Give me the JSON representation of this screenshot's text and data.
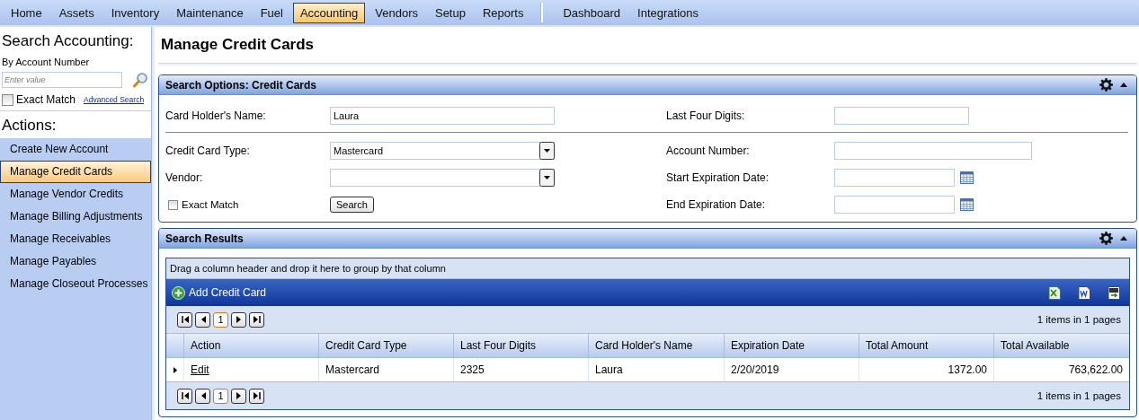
{
  "menu": {
    "items": [
      {
        "label": "Home",
        "selected": false
      },
      {
        "label": "Assets",
        "selected": false
      },
      {
        "label": "Inventory",
        "selected": false
      },
      {
        "label": "Maintenance",
        "selected": false
      },
      {
        "label": "Fuel",
        "selected": false
      },
      {
        "label": "Accounting",
        "selected": true
      },
      {
        "label": "Vendors",
        "selected": false
      },
      {
        "label": "Setup",
        "selected": false
      },
      {
        "label": "Reports",
        "selected": false
      }
    ],
    "extra_items": [
      {
        "label": "Dashboard",
        "selected": false
      },
      {
        "label": "Integrations",
        "selected": false
      }
    ]
  },
  "sidebar": {
    "search_title": "Search Accounting:",
    "search_by": "By Account Number",
    "search_field": {
      "placeholder": "Enter value"
    },
    "exact_match": {
      "label": "Exact Match",
      "checked": false
    },
    "advanced_link": "Advanced Search",
    "actions_title": "Actions:",
    "actions": [
      {
        "label": "Create New Account",
        "selected": false
      },
      {
        "label": "Manage Credit Cards",
        "selected": true
      },
      {
        "label": "Manage Vendor Credits",
        "selected": false
      },
      {
        "label": "Manage Billing Adjustments",
        "selected": false
      },
      {
        "label": "Manage Receivables",
        "selected": false
      },
      {
        "label": "Manage Payables",
        "selected": false
      },
      {
        "label": "Manage Closeout Processes",
        "selected": false
      }
    ]
  },
  "page_title": "Manage Credit Cards",
  "search_panel": {
    "title": "Search Options: Credit Cards",
    "left_fields": [
      {
        "kind": "text",
        "label": "Card Holder's Name:",
        "value": "Laura"
      },
      {
        "kind": "select",
        "label": "Credit Card Type:",
        "value": "Mastercard"
      },
      {
        "kind": "select",
        "label": "Vendor:"
      }
    ],
    "right_fields": [
      {
        "kind": "text",
        "label": "Last Four Digits:"
      },
      {
        "kind": "text",
        "label": "Account Number:"
      },
      {
        "kind": "date",
        "label": "Start Expiration Date:"
      },
      {
        "kind": "date",
        "label": "End Expiration Date:"
      }
    ],
    "exact_match": {
      "label": "Exact Match",
      "checked": false
    },
    "search_button": "Search"
  },
  "results_panel": {
    "title": "Search Results",
    "group_hint": "Drag a column header and drop it here to group by that column",
    "add_button": "Add Credit Card",
    "top_pager": {
      "page": "1",
      "summary": "1 items in 1 pages"
    },
    "columns": [
      "Action",
      "Credit Card Type",
      "Last Four Digits",
      "Card Holder's Name",
      "Expiration Date",
      "Total Amount",
      "Total Available"
    ],
    "rows": [
      {
        "cells": [
          "Edit",
          "Mastercard",
          "2325",
          "Laura",
          "2/20/2019",
          "1372.00",
          "763,622.00"
        ]
      }
    ],
    "bottom_pager": {
      "page": "1",
      "summary": "1 items in 1 pages"
    }
  }
}
